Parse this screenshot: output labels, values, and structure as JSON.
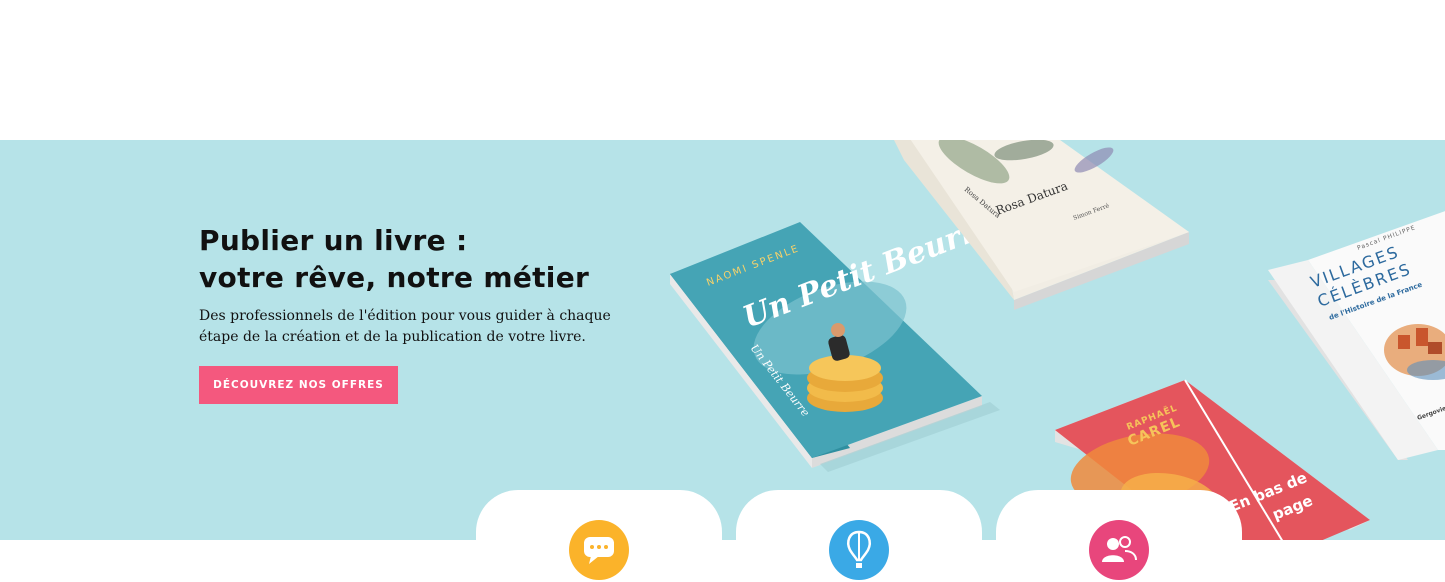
{
  "hero": {
    "title_line1": "Publier un livre :",
    "title_line2": "votre rêve, notre métier",
    "subtitle": "Des professionnels de l'édition pour vous guider à chaque étape de la création et de la publication de votre livre.",
    "cta_label": "DÉCOUVREZ NOS OFFRES"
  },
  "books": [
    {
      "author": "NAOMI SPENLE",
      "title": "Un Petit Beurre",
      "spine": "Un Petit Beurre"
    },
    {
      "title": "Rosa Datura",
      "author": "Simon Ferré",
      "spine": "Rosa Datura"
    },
    {
      "author": "Pascal PHILIPPE",
      "title_line1": "VILLAGES",
      "title_line2": "CÉLÈBRES",
      "subtitle": "de l'Histoire de la France",
      "back_text": "Gergovie, Dolent, Colombey, Sainte..."
    },
    {
      "author": "RAPHAËL",
      "author_last": "CAREL",
      "title_line1": "En bas de",
      "title_line2": "page"
    }
  ],
  "colors": {
    "hero_bg": "#b6e3e8",
    "cta_bg": "#f4587e",
    "icon_chat": "#fbb32a",
    "icon_balloon": "#3aa9e6",
    "icon_people": "#e8467c"
  },
  "cards": [
    {
      "icon": "chat-bubble-icon"
    },
    {
      "icon": "hot-air-balloon-icon"
    },
    {
      "icon": "people-icon"
    }
  ]
}
